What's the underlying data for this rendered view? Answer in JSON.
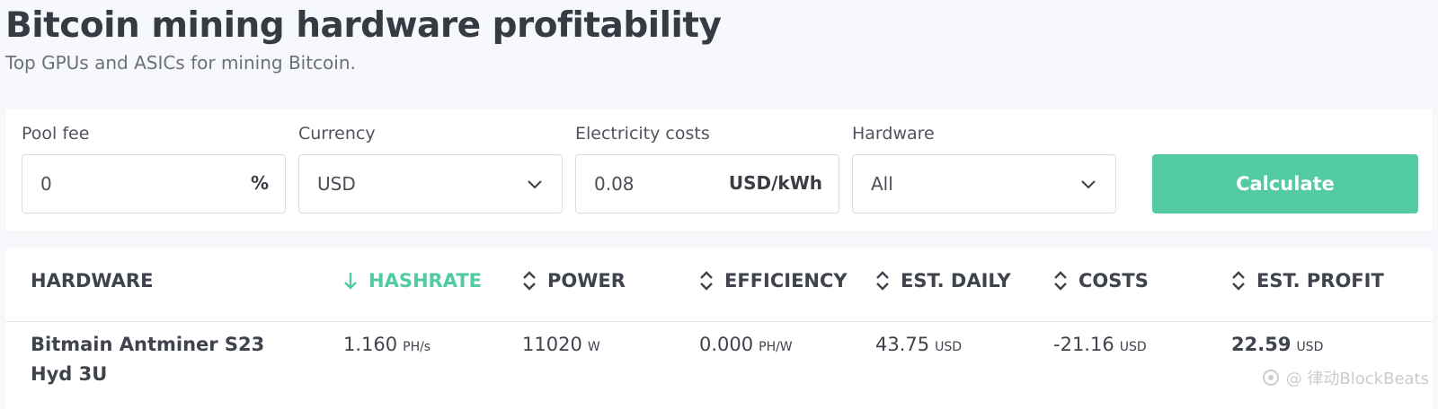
{
  "header": {
    "title": "Bitcoin mining hardware profitability",
    "subtitle": "Top GPUs and ASICs for mining Bitcoin."
  },
  "filters": {
    "pool_fee": {
      "label": "Pool fee",
      "value": "0",
      "suffix": "%"
    },
    "currency": {
      "label": "Currency",
      "value": "USD"
    },
    "electricity": {
      "label": "Electricity costs",
      "value": "0.08",
      "suffix": "USD/kWh"
    },
    "hardware": {
      "label": "Hardware",
      "value": "All"
    },
    "calculate_label": "Calculate"
  },
  "table": {
    "columns": {
      "hardware": "HARDWARE",
      "hashrate": "HASHRATE",
      "power": "POWER",
      "efficiency": "EFFICIENCY",
      "est_daily": "EST. DAILY",
      "costs": "COSTS",
      "est_profit": "EST. PROFIT"
    },
    "rows": [
      {
        "hardware": "Bitmain Antminer S23 Hyd 3U",
        "hashrate": "1.160",
        "hashrate_unit": "PH/s",
        "power": "11020",
        "power_unit": "W",
        "efficiency": "0.000",
        "efficiency_unit": "PH/W",
        "est_daily": "43.75",
        "est_daily_unit": "USD",
        "costs": "-21.16",
        "costs_unit": "USD",
        "est_profit": "22.59",
        "est_profit_unit": "USD"
      }
    ]
  },
  "watermark": "@ 律动BlockBeats",
  "colors": {
    "accent": "#52cba1",
    "text": "#3f434b",
    "border": "#d9dce2"
  }
}
